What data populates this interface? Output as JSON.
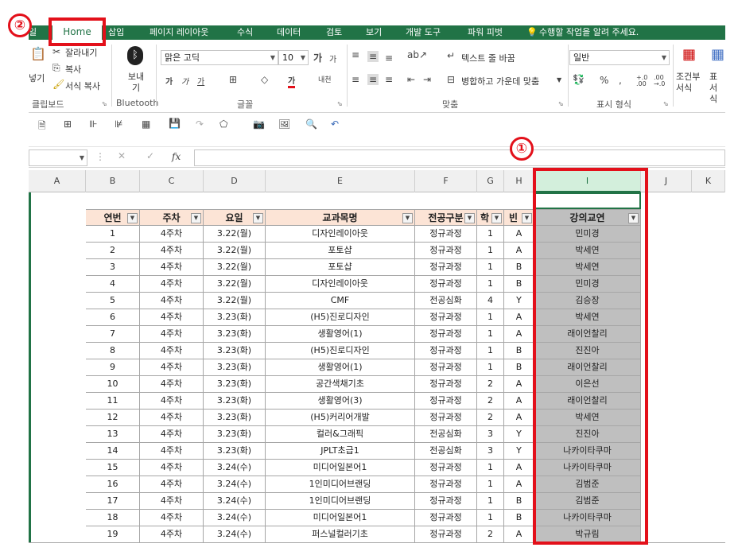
{
  "annotations": {
    "badge1": "①",
    "badge2": "②"
  },
  "tabs": {
    "file": "일",
    "home": "Home",
    "insert": "삽입",
    "page_layout": "페이지 레이아웃",
    "formulas": "수식",
    "data": "데이터",
    "review": "검토",
    "view": "보기",
    "developer": "개발 도구",
    "power_pivot": "파워 피벗",
    "tell_me": "수행할 작업을 알려 주세요."
  },
  "ribbon": {
    "clipboard": {
      "paste": "넣기",
      "cut": "잘라내기",
      "copy": "복사",
      "format_painter": "서식 복사",
      "label": "클립보드"
    },
    "bluetooth": {
      "send": "보내기",
      "label": "Bluetooth"
    },
    "font": {
      "name": "맑은 고딕",
      "size": "10",
      "label": "글꼴",
      "bold": "가",
      "italic": "가",
      "underline": "가",
      "grow": "가",
      "shrink": "가",
      "color_a": "가",
      "phonetic": "내천"
    },
    "alignment": {
      "wrap": "텍스트 줄 바꿈",
      "merge": "병합하고 가운데 맞춤",
      "label": "맞춤"
    },
    "number": {
      "format": "일반",
      "percent": "%",
      "comma": ",",
      "label": "표시 형식",
      "inc": "+.0 .00",
      "dec": ".00 →.0"
    },
    "styles": {
      "conditional": "조건부 서식",
      "table": "표 서식"
    }
  },
  "formula_bar": {
    "fx": "fx"
  },
  "columns": [
    "A",
    "B",
    "C",
    "D",
    "E",
    "F",
    "G",
    "H",
    "I",
    "J",
    "K"
  ],
  "table": {
    "headers": [
      "연번",
      "주차",
      "요일",
      "교과목명",
      "전공구분",
      "학",
      "빈",
      "강의교연"
    ],
    "rows": [
      [
        "1",
        "4주차",
        "3.22(월)",
        "디자인레이아웃",
        "정규과정",
        "1",
        "A",
        "민미경"
      ],
      [
        "2",
        "4주차",
        "3.22(월)",
        "포토샵",
        "정규과정",
        "1",
        "A",
        "박세연"
      ],
      [
        "3",
        "4주차",
        "3.22(월)",
        "포토샵",
        "정규과정",
        "1",
        "B",
        "박세연"
      ],
      [
        "4",
        "4주차",
        "3.22(월)",
        "디자인레이아웃",
        "정규과정",
        "1",
        "B",
        "민미경"
      ],
      [
        "5",
        "4주차",
        "3.22(월)",
        "CMF",
        "전공심화",
        "4",
        "Y",
        "김승장"
      ],
      [
        "6",
        "4주차",
        "3.23(화)",
        "(H5)진로디자인",
        "정규과정",
        "1",
        "A",
        "박세연"
      ],
      [
        "7",
        "4주차",
        "3.23(화)",
        "생활영어(1)",
        "정규과정",
        "1",
        "A",
        "래이언찰리"
      ],
      [
        "8",
        "4주차",
        "3.23(화)",
        "(H5)진로디자인",
        "정규과정",
        "1",
        "B",
        "진진아"
      ],
      [
        "9",
        "4주차",
        "3.23(화)",
        "생활영어(1)",
        "정규과정",
        "1",
        "B",
        "래이언찰리"
      ],
      [
        "10",
        "4주차",
        "3.23(화)",
        "공간색채기초",
        "정규과정",
        "2",
        "A",
        "이은선"
      ],
      [
        "11",
        "4주차",
        "3.23(화)",
        "생활영어(3)",
        "정규과정",
        "2",
        "A",
        "래이언찰리"
      ],
      [
        "12",
        "4주차",
        "3.23(화)",
        "(H5)커리어개발",
        "정규과정",
        "2",
        "A",
        "박세연"
      ],
      [
        "13",
        "4주차",
        "3.23(화)",
        "컬러&그래픽",
        "전공심화",
        "3",
        "Y",
        "진진아"
      ],
      [
        "14",
        "4주차",
        "3.23(화)",
        "JPLT초급1",
        "전공심화",
        "3",
        "Y",
        "나카이타쿠마"
      ],
      [
        "15",
        "4주차",
        "3.24(수)",
        "미디어일본어1",
        "정규과정",
        "1",
        "A",
        "나카이타쿠마"
      ],
      [
        "16",
        "4주차",
        "3.24(수)",
        "1인미디어브랜딩",
        "정규과정",
        "1",
        "A",
        "김범준"
      ],
      [
        "17",
        "4주차",
        "3.24(수)",
        "1인미디어브랜딩",
        "정규과정",
        "1",
        "B",
        "김범준"
      ],
      [
        "18",
        "4주차",
        "3.24(수)",
        "미디어일본어1",
        "정규과정",
        "1",
        "B",
        "나카이타쿠마"
      ],
      [
        "19",
        "4주차",
        "3.24(수)",
        "퍼스널컬러기초",
        "정규과정",
        "2",
        "A",
        "박규림"
      ]
    ]
  }
}
